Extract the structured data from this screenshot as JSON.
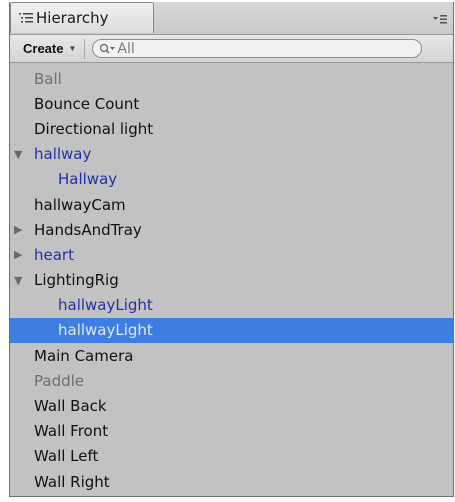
{
  "panel": {
    "tab_label": "Hierarchy",
    "tab_icon": "hierarchy-list-icon",
    "menu_icon": "panel-menu-icon"
  },
  "toolbar": {
    "create_label": "Create",
    "search_placeholder": "All",
    "search_icon": "search-icon"
  },
  "tree": {
    "items": [
      {
        "label": "Ball",
        "style": "inactive",
        "depth": 0,
        "arrow": ""
      },
      {
        "label": "Bounce Count",
        "style": "normal",
        "depth": 0,
        "arrow": ""
      },
      {
        "label": "Directional light",
        "style": "normal",
        "depth": 0,
        "arrow": ""
      },
      {
        "label": "hallway",
        "style": "prefab",
        "depth": 0,
        "arrow": "expanded"
      },
      {
        "label": "Hallway",
        "style": "prefab",
        "depth": 1,
        "arrow": ""
      },
      {
        "label": "hallwayCam",
        "style": "normal",
        "depth": 0,
        "arrow": ""
      },
      {
        "label": "HandsAndTray",
        "style": "normal",
        "depth": 0,
        "arrow": "collapsed"
      },
      {
        "label": "heart",
        "style": "prefab",
        "depth": 0,
        "arrow": "collapsed"
      },
      {
        "label": "LightingRig",
        "style": "normal",
        "depth": 0,
        "arrow": "expanded"
      },
      {
        "label": "hallwayLight",
        "style": "prefab",
        "depth": 1,
        "arrow": ""
      },
      {
        "label": "hallwayLight",
        "style": "selected",
        "depth": 1,
        "arrow": ""
      },
      {
        "label": "Main Camera",
        "style": "normal",
        "depth": 0,
        "arrow": ""
      },
      {
        "label": "Paddle",
        "style": "inactive",
        "depth": 0,
        "arrow": ""
      },
      {
        "label": "Wall Back",
        "style": "normal",
        "depth": 0,
        "arrow": ""
      },
      {
        "label": "Wall Front",
        "style": "normal",
        "depth": 0,
        "arrow": ""
      },
      {
        "label": "Wall Left",
        "style": "normal",
        "depth": 0,
        "arrow": ""
      },
      {
        "label": "Wall Right",
        "style": "normal",
        "depth": 0,
        "arrow": ""
      }
    ]
  },
  "colors": {
    "selection": "#3e7ee0",
    "prefab_text": "#2431a6",
    "inactive_text": "#6e6e6e",
    "panel_bg": "#c2c2c2"
  }
}
